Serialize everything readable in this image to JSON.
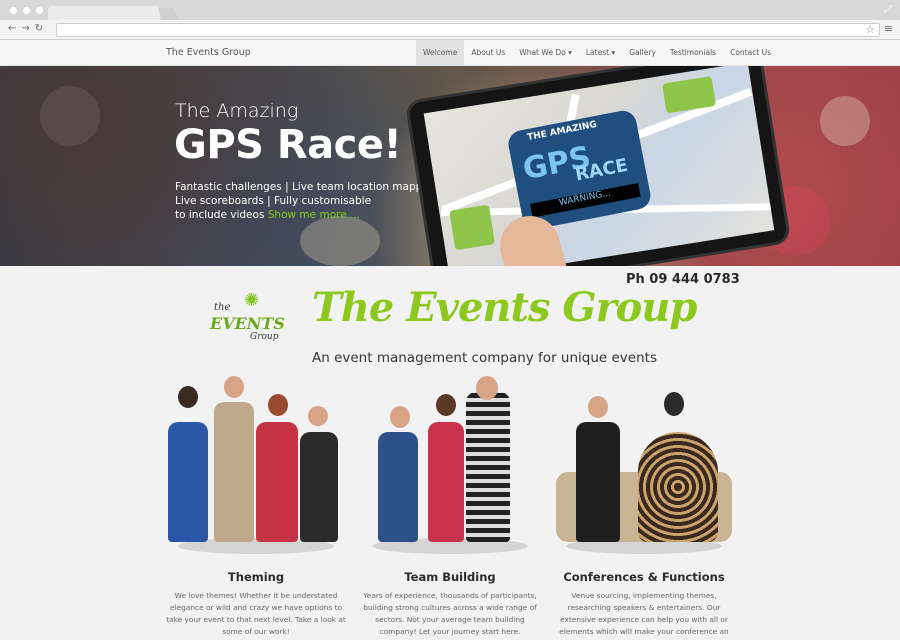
{
  "nav": {
    "brand": "The Events Group",
    "items": [
      {
        "label": "Welcome",
        "active": true
      },
      {
        "label": "About Us"
      },
      {
        "label": "What We Do ▾"
      },
      {
        "label": "Latest ▾"
      },
      {
        "label": "Gallery"
      },
      {
        "label": "Testimonials"
      },
      {
        "label": "Contact Us"
      }
    ]
  },
  "hero": {
    "subtitle": "The Amazing",
    "title": "GPS Race!",
    "line1": "Fantastic challenges | Live team location mapping",
    "line2": "Live scoreboards | Fully customisable",
    "line3": "to include videos",
    "show_more": "Show me more ...",
    "tablet_amazing": "THE AMAZING",
    "tablet_gps": "GPS",
    "tablet_race": "RACE",
    "tablet_warning": "WARNING..."
  },
  "contact": {
    "phone": "Ph 09 444 0783"
  },
  "logo": {
    "the": "the",
    "events": "EVENTS",
    "group": "Group"
  },
  "headline": {
    "title": "The Events Group",
    "tagline": "An event management company for unique events"
  },
  "columns": [
    {
      "title": "Theming",
      "text": "We love themes! Whether it be understated elegance or wild and crazy we have options to take your event to that next level. Take a look at some of our work!"
    },
    {
      "title": "Team Building",
      "text": "Years of experience, thousands of participants, building strong cultures across a wide range of sectors. Not your average team building company! Let your journey start here."
    },
    {
      "title": "Conferences & Functions",
      "text": "Venue sourcing, implementing themes, researching speakers & entertainers. Our extensive experience can help you with all or elements which will make your conference an event to remember – for all the"
    }
  ],
  "colors": {
    "accent": "#8cc81d",
    "hero_text": "#ffffff",
    "nav_bg": "#f7f7f7"
  },
  "icons": [
    "back-icon",
    "forward-icon",
    "reload-icon",
    "star-icon",
    "menu-icon",
    "expand-icon"
  ]
}
